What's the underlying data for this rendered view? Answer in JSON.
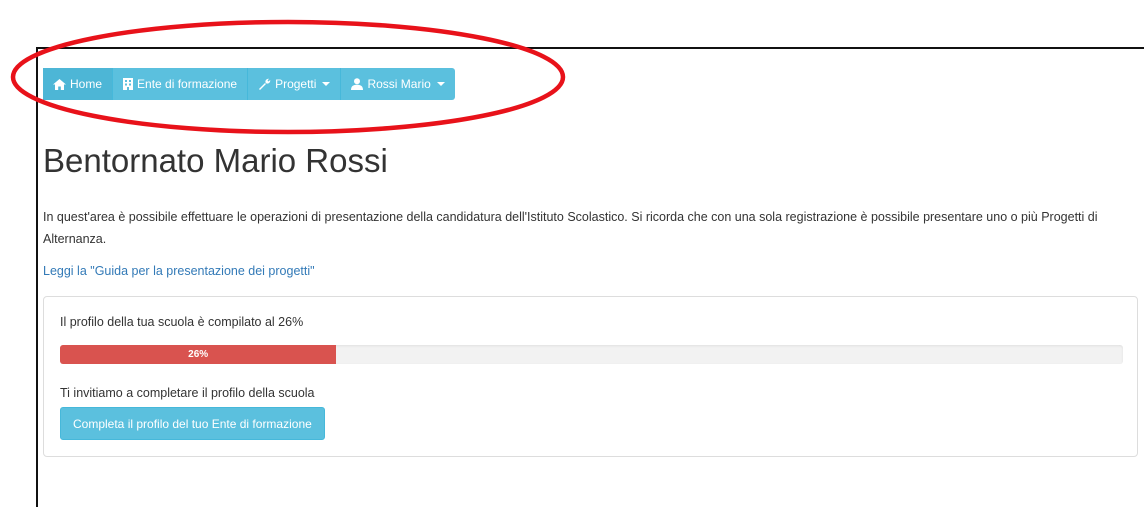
{
  "nav": {
    "items": [
      {
        "label": "Home",
        "icon": "home-icon"
      },
      {
        "label": "Ente di formazione",
        "icon": "building-icon"
      },
      {
        "label": "Progetti",
        "icon": "wrench-icon",
        "dropdown": true
      },
      {
        "label": "Rossi Mario",
        "icon": "user-icon",
        "dropdown": true
      }
    ]
  },
  "main": {
    "title": "Bentornato Mario Rossi",
    "intro": "In quest'area è possibile effettuare le operazioni di presentazione della candidatura dell'Istituto Scolastico. Si ricorda che con una sola registrazione è possibile presentare uno o più Progetti di Alternanza.",
    "guide_link": "Leggi la \"Guida per la presentazione dei progetti\""
  },
  "profile_panel": {
    "status_text": "Il profilo della tua scuola è compilato al 26%",
    "progress_value": 26,
    "progress_label": "26%",
    "invite_text": "Ti invitiamo a completare il profilo della scuola",
    "button_label": "Completa il profilo del tuo Ente di formazione"
  },
  "colors": {
    "accent": "#5bc0de",
    "progress": "#d9534f",
    "link": "#337ab7",
    "annotation": "#e8121a"
  }
}
